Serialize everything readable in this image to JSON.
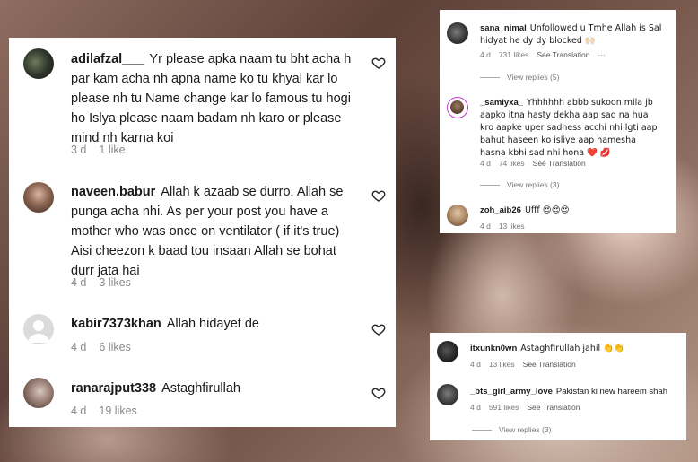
{
  "panel_left": {
    "comments": [
      {
        "username": "adilafzal___",
        "text": "Yr please apka naam tu bht acha h par kam acha nh apna name ko tu khyal kar lo please nh tu Name change kar lo famous tu hogi ho Islya please naam badam nh karo or please mind nh karna koi",
        "time": "3 d",
        "likes": "1 like"
      },
      {
        "username": "naveen.babur",
        "text": "Allah k azaab se durro. Allah se punga acha nhi. As per your post you have a mother who was once on ventilator ( if it's true) Aisi cheezon k baad tou insaan Allah se bohat durr jata hai",
        "time": "4 d",
        "likes": "3 likes"
      },
      {
        "username": "kabir7373khan",
        "text": "Allah hidayet de",
        "time": "4 d",
        "likes": "6 likes"
      },
      {
        "username": "ranarajput338",
        "text": "Astaghfirullah",
        "time": "4 d",
        "likes": "19 likes"
      }
    ]
  },
  "panel_top_right": {
    "comments": [
      {
        "username": "sana_nimal",
        "text": "Unfollowed u Tmhe Allah is Sal hidyat he dy dy blocked 🙌🏻",
        "time": "4 d",
        "likes": "731 likes",
        "see_translation": "See Translation",
        "more": "···",
        "view_replies": "View replies (5)"
      },
      {
        "username": "_samiyxa_",
        "text": "Yhhhhhh abbb sukoon mila jb aapko itna hasty dekha aap sad na hua kro aapke uper sadness acchi nhi lgti aap bahut haseen ko isliye aap hamesha hasna kbhi sad nhi hona ❤️ 💋",
        "time": "4 d",
        "likes": "74 likes",
        "see_translation": "See Translation",
        "view_replies": "View replies (3)"
      },
      {
        "username": "zoh_aib26",
        "text": "Ufff 😍😍😍",
        "time": "4 d",
        "likes": "13 likes"
      }
    ]
  },
  "panel_bottom_right": {
    "comments": [
      {
        "username": "itxunkn0wn",
        "text": "Astaghfirullah jahil 👏👏",
        "time": "4 d",
        "likes": "13 likes",
        "see_translation": "See Translation"
      },
      {
        "username": "_bts_girl_army_love",
        "text": "Pakistan ki new hareem shah",
        "time": "4 d",
        "likes": "591 likes",
        "see_translation": "See Translation",
        "view_replies": "View replies (3)"
      }
    ]
  },
  "icons": {
    "like": "heart-outline-icon",
    "default_avatar": "person-icon"
  },
  "colors": {
    "text": "#1a1a1a",
    "meta": "#8a8a8a",
    "panel_bg": "#ffffff"
  }
}
